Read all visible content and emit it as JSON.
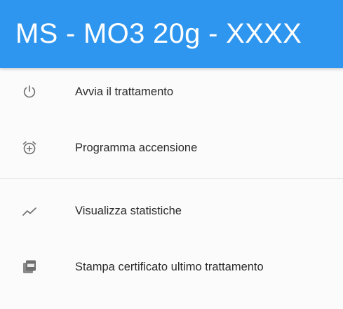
{
  "header": {
    "title": "MS - MO3 20g - XXXX",
    "color": "#2f96ef"
  },
  "menu": {
    "group_1": [
      {
        "label": "Avvia il trattamento",
        "icon": "power-icon"
      },
      {
        "label": "Programma accensione",
        "icon": "alarm-add-icon"
      }
    ],
    "group_2": [
      {
        "label": "Visualizza statistiche",
        "icon": "trending-up-icon"
      },
      {
        "label": "Stampa certificato ultimo trattamento",
        "icon": "pdf-icon"
      }
    ]
  }
}
